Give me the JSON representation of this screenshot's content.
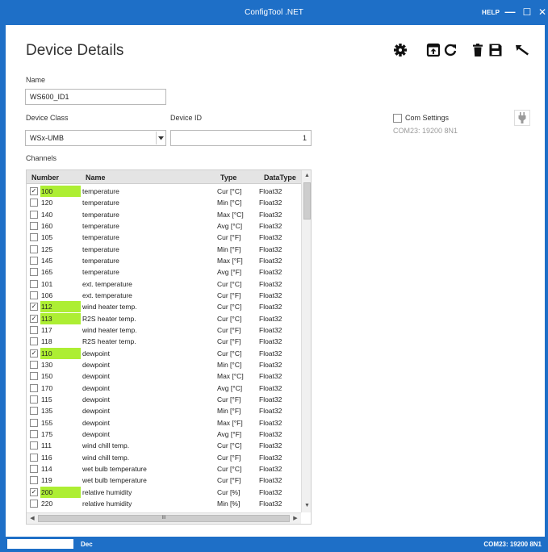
{
  "window": {
    "title": "ConfigTool .NET",
    "help_label": "HELP",
    "minimize_glyph": "—",
    "maximize_glyph": "☐",
    "close_glyph": "✕"
  },
  "page": {
    "title": "Device Details"
  },
  "toolbar": {
    "icons": [
      "gear-icon",
      "upload-window-icon",
      "refresh-icon",
      "trash-icon",
      "save-icon",
      "undo-icon"
    ]
  },
  "form": {
    "name_label": "Name",
    "name_value": "WS600_ID1",
    "device_class_label": "Device Class",
    "device_class_value": "WSx-UMB",
    "device_id_label": "Device ID",
    "device_id_value": "1",
    "channels_label": "Channels"
  },
  "com": {
    "label": "Com Settings",
    "info": "COM23: 19200 8N1",
    "plug_icon": "plug-icon"
  },
  "table": {
    "headers": {
      "number": "Number",
      "name": "Name",
      "type": "Type",
      "datatype": "DataType"
    },
    "rows": [
      {
        "checked": true,
        "number": "100",
        "name": "temperature",
        "type": "Cur [°C]",
        "datatype": "Float32"
      },
      {
        "checked": false,
        "number": "120",
        "name": "temperature",
        "type": "Min [°C]",
        "datatype": "Float32"
      },
      {
        "checked": false,
        "number": "140",
        "name": "temperature",
        "type": "Max [°C]",
        "datatype": "Float32"
      },
      {
        "checked": false,
        "number": "160",
        "name": "temperature",
        "type": "Avg [°C]",
        "datatype": "Float32"
      },
      {
        "checked": false,
        "number": "105",
        "name": "temperature",
        "type": "Cur [°F]",
        "datatype": "Float32"
      },
      {
        "checked": false,
        "number": "125",
        "name": "temperature",
        "type": "Min [°F]",
        "datatype": "Float32"
      },
      {
        "checked": false,
        "number": "145",
        "name": "temperature",
        "type": "Max [°F]",
        "datatype": "Float32"
      },
      {
        "checked": false,
        "number": "165",
        "name": "temperature",
        "type": "Avg [°F]",
        "datatype": "Float32"
      },
      {
        "checked": false,
        "number": "101",
        "name": "ext. temperature",
        "type": "Cur [°C]",
        "datatype": "Float32"
      },
      {
        "checked": false,
        "number": "106",
        "name": "ext. temperature",
        "type": "Cur [°F]",
        "datatype": "Float32"
      },
      {
        "checked": true,
        "number": "112",
        "name": "wind heater temp.",
        "type": "Cur [°C]",
        "datatype": "Float32"
      },
      {
        "checked": true,
        "number": "113",
        "name": "R2S heater temp.",
        "type": "Cur [°C]",
        "datatype": "Float32"
      },
      {
        "checked": false,
        "number": "117",
        "name": "wind heater temp.",
        "type": "Cur [°F]",
        "datatype": "Float32"
      },
      {
        "checked": false,
        "number": "118",
        "name": "R2S heater temp.",
        "type": "Cur [°F]",
        "datatype": "Float32"
      },
      {
        "checked": true,
        "number": "110",
        "name": "dewpoint",
        "type": "Cur [°C]",
        "datatype": "Float32"
      },
      {
        "checked": false,
        "number": "130",
        "name": "dewpoint",
        "type": "Min [°C]",
        "datatype": "Float32"
      },
      {
        "checked": false,
        "number": "150",
        "name": "dewpoint",
        "type": "Max [°C]",
        "datatype": "Float32"
      },
      {
        "checked": false,
        "number": "170",
        "name": "dewpoint",
        "type": "Avg [°C]",
        "datatype": "Float32"
      },
      {
        "checked": false,
        "number": "115",
        "name": "dewpoint",
        "type": "Cur [°F]",
        "datatype": "Float32"
      },
      {
        "checked": false,
        "number": "135",
        "name": "dewpoint",
        "type": "Min [°F]",
        "datatype": "Float32"
      },
      {
        "checked": false,
        "number": "155",
        "name": "dewpoint",
        "type": "Max [°F]",
        "datatype": "Float32"
      },
      {
        "checked": false,
        "number": "175",
        "name": "dewpoint",
        "type": "Avg [°F]",
        "datatype": "Float32"
      },
      {
        "checked": false,
        "number": "111",
        "name": "wind chill temp.",
        "type": "Cur [°C]",
        "datatype": "Float32"
      },
      {
        "checked": false,
        "number": "116",
        "name": "wind chill temp.",
        "type": "Cur [°F]",
        "datatype": "Float32"
      },
      {
        "checked": false,
        "number": "114",
        "name": "wet bulb temperature",
        "type": "Cur [°C]",
        "datatype": "Float32"
      },
      {
        "checked": false,
        "number": "119",
        "name": "wet bulb temperature",
        "type": "Cur [°F]",
        "datatype": "Float32"
      },
      {
        "checked": true,
        "number": "200",
        "name": "relative humidity",
        "type": "Cur [%]",
        "datatype": "Float32"
      },
      {
        "checked": false,
        "number": "220",
        "name": "relative humidity",
        "type": "Min [%]",
        "datatype": "Float32"
      }
    ],
    "scroll_grip": "III"
  },
  "status": {
    "mode": "Dec",
    "com": "COM23: 19200 8N1"
  },
  "colors": {
    "accent": "#1e6fc7",
    "highlight": "#adee33"
  }
}
